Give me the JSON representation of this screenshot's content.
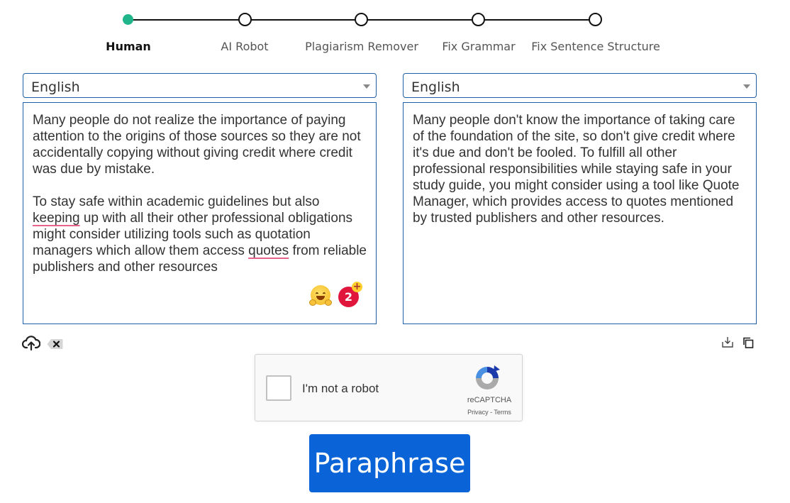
{
  "stepper": {
    "steps": [
      {
        "label": "Human"
      },
      {
        "label": "AI Robot"
      },
      {
        "label": "Plagiarism Remover"
      },
      {
        "label": "Fix Grammar"
      },
      {
        "label": "Fix Sentence Structure"
      }
    ],
    "active_index": 0,
    "accent_color": "#20b58a"
  },
  "input": {
    "language": "English",
    "paragraph1": "Many people do not realize the importance of paying attention to the origins of those sources so they are not accidentally copying without giving credit where credit was due by mistake.",
    "paragraph2_part1": "To stay safe within academic guidelines but also ",
    "paragraph2_word1": "keeping",
    "paragraph2_part2": " up with all their other professional obligations might consider utilizing tools such as quotation managers which allow them access ",
    "paragraph2_word2": "quotes",
    "paragraph2_part3": " from reliable publishers and other resources",
    "grammar_badge_count": "2",
    "badge_plus": "+"
  },
  "output": {
    "language": "English",
    "text": "Many people don't know the importance of taking care of the foundation of the site, so don't give credit where it's due and don't be fooled. To fulfill all other professional responsibilities while staying safe in your study guide, you might consider using a tool like Quote Manager, which provides access to quotes mentioned by trusted publishers and other resources."
  },
  "recaptcha": {
    "label": "I'm not a robot",
    "brand": "reCAPTCHA",
    "privacy": "Privacy",
    "separator": " - ",
    "terms": "Terms"
  },
  "actions": {
    "paraphrase_label": "Paraphrase",
    "button_color": "#0a64d8"
  },
  "icons": {
    "upload": "cloud-upload-icon",
    "clear": "clear-icon",
    "download": "download-icon",
    "copy": "copy-icon",
    "emoji": "hugging-face-emoji-icon"
  }
}
